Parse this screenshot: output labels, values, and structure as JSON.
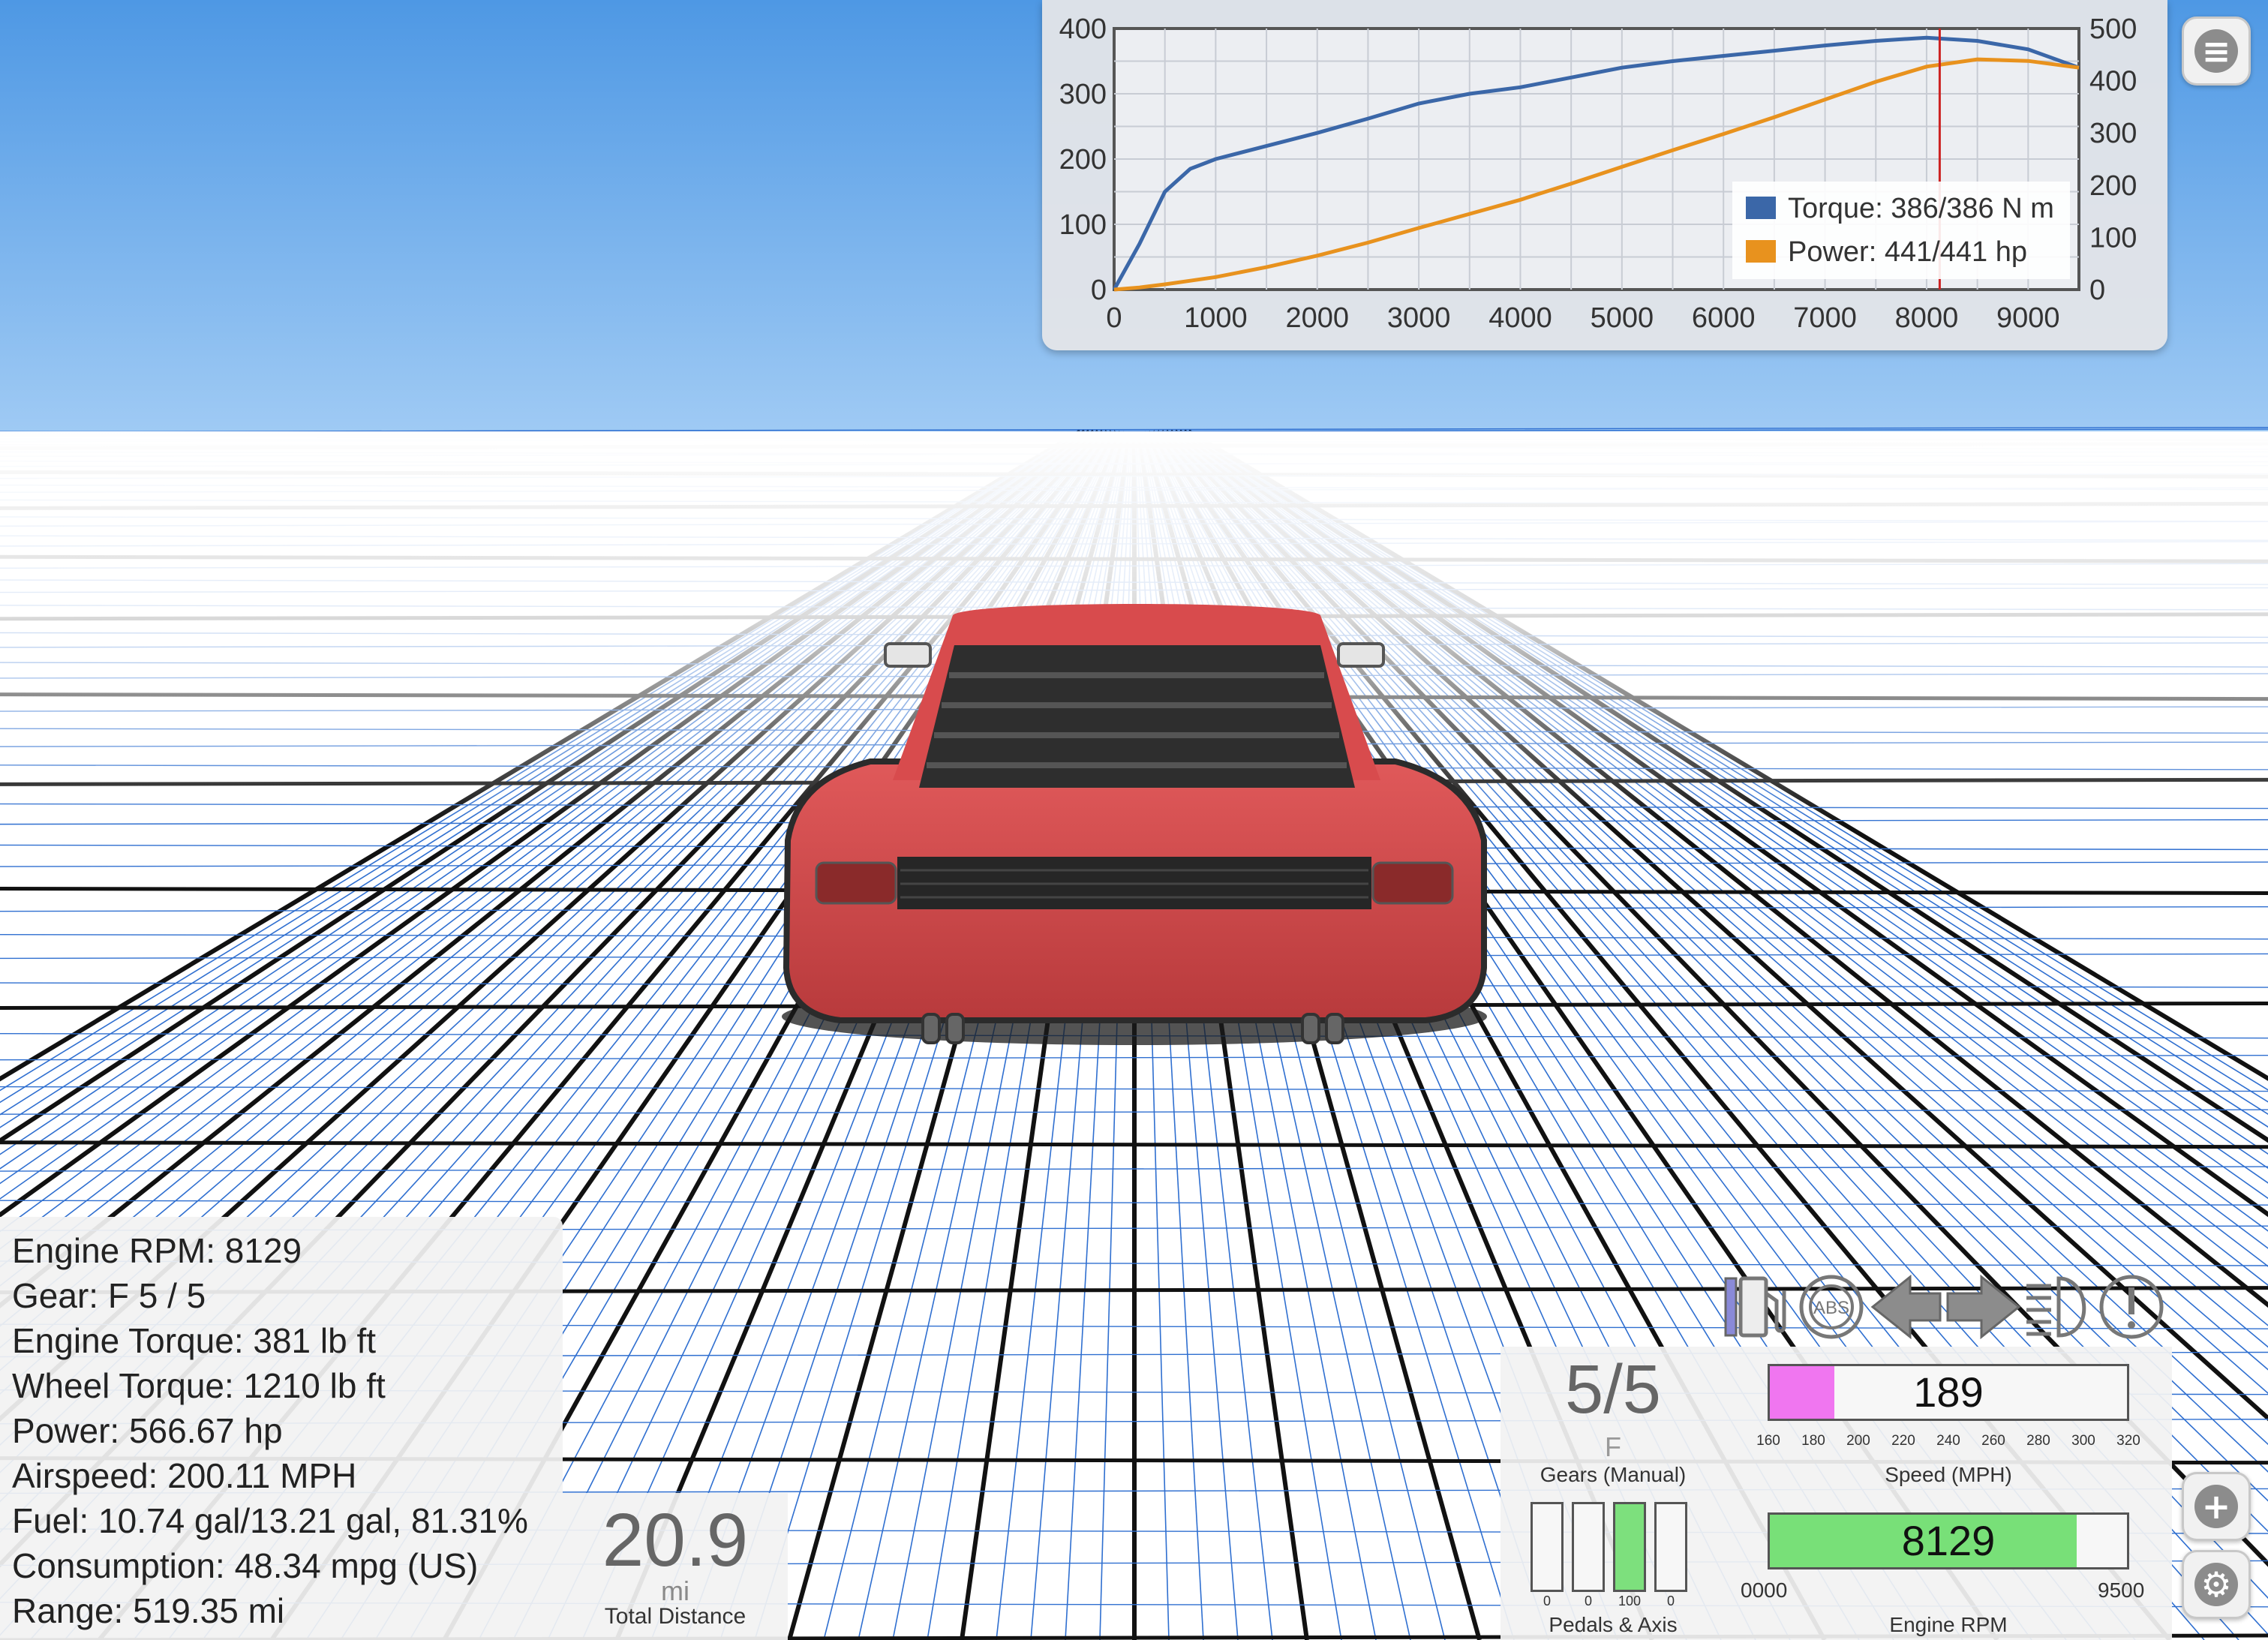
{
  "graph": {
    "torque_legend": "Torque: 386/386 N m",
    "power_legend": "Power: 441/441 hp",
    "torque_color": "#3b67a8",
    "power_color": "#e8921e",
    "marker_color": "#cc2222"
  },
  "chart_data": {
    "type": "line",
    "x": [
      0,
      250,
      500,
      750,
      1000,
      1500,
      2000,
      2500,
      3000,
      3500,
      4000,
      4500,
      5000,
      5500,
      6000,
      6500,
      7000,
      7500,
      8000,
      8500,
      9000,
      9500
    ],
    "series": [
      {
        "name": "Torque",
        "axis": "left",
        "values": [
          0,
          70,
          150,
          185,
          200,
          220,
          240,
          262,
          285,
          300,
          310,
          325,
          340,
          350,
          358,
          366,
          374,
          381,
          386,
          381,
          368,
          340
        ]
      },
      {
        "name": "Power",
        "axis": "right",
        "values": [
          0,
          4,
          10,
          17,
          24,
          43,
          65,
          90,
          118,
          145,
          172,
          203,
          235,
          267,
          298,
          330,
          364,
          398,
          427,
          441,
          438,
          425
        ]
      }
    ],
    "x_ticks": [
      0,
      1000,
      2000,
      3000,
      4000,
      5000,
      6000,
      7000,
      8000,
      9000
    ],
    "left_ticks": [
      0,
      100,
      200,
      300,
      400
    ],
    "right_ticks": [
      0,
      100,
      200,
      300,
      400,
      500
    ],
    "xlim": [
      0,
      9500
    ],
    "ylim_left": [
      0,
      400
    ],
    "ylim_right": [
      0,
      500
    ],
    "marker_rpm": 8129,
    "grid": true,
    "legend": "bottom-right"
  },
  "menu_icon": "menu-icon",
  "stats": [
    "Engine RPM: 8129",
    "Gear: F 5 / 5",
    "Engine Torque: 381 lb ft",
    "Wheel Torque: 1210 lb ft",
    "Power: 566.67 hp",
    "Airspeed: 200.11 MPH",
    "Fuel: 10.74 gal/13.21 gal, 81.31%",
    "Consumption: 48.34 mpg (US)",
    "Range: 519.35 mi"
  ],
  "distance": {
    "value": "20.9",
    "unit": "mi",
    "label": "Total Distance"
  },
  "indicators": [
    "fuel-pump-icon",
    "abs-icon",
    "left-turn-signal-icon",
    "right-turn-signal-icon",
    "headlight-icon",
    "warning-icon"
  ],
  "indicator_text": {
    "abs": "ABS"
  },
  "gears": {
    "value": "5/5",
    "mode": "F",
    "label": "Gears (Manual)"
  },
  "pedals": {
    "label": "Pedals & Axis",
    "levels": [
      0,
      0,
      1,
      0
    ],
    "ticks": [
      "0",
      "0",
      "100",
      "0"
    ]
  },
  "speed": {
    "value": "189",
    "fill_fraction": 0.18,
    "label": "Speed (MPH)",
    "ticks": [
      "160",
      "180",
      "200",
      "220",
      "240",
      "260",
      "280",
      "300",
      "320"
    ]
  },
  "rpm": {
    "value": "8129",
    "fill_fraction": 0.86,
    "min": "0000",
    "max": "9500",
    "label": "Engine RPM"
  },
  "side_buttons": [
    "add-icon",
    "settings-icon"
  ]
}
